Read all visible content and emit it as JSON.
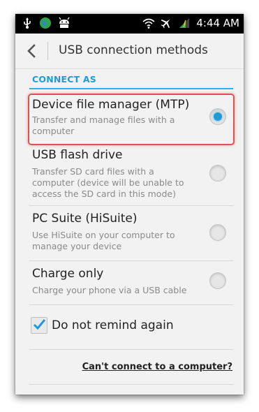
{
  "status_bar": {
    "time": "4:44 AM",
    "icons_left": [
      "usb-icon",
      "globe-icon",
      "android-icon"
    ],
    "icons_right": [
      "wifi-icon",
      "airplane-icon",
      "battery-icon"
    ]
  },
  "action_bar": {
    "title": "USB connection methods"
  },
  "section": {
    "header": "CONNECT AS"
  },
  "options": [
    {
      "title": "Device file manager (MTP)",
      "desc": "Transfer and manage files with a computer",
      "checked": true
    },
    {
      "title": "USB flash drive",
      "desc": "Transfer SD card files with a computer (device will be unable to access the SD card in this mode)",
      "checked": false
    },
    {
      "title": "PC Suite (HiSuite)",
      "desc": "Use HiSuite on your computer to manage your device",
      "checked": false
    },
    {
      "title": "Charge only",
      "desc": "Charge your phone via a USB cable",
      "checked": false
    }
  ],
  "do_not_remind": {
    "label": "Do not remind again",
    "checked": true
  },
  "help_link": "Can't connect to a computer?",
  "colors": {
    "accent": "#1f9bd7",
    "highlight_border": "#d9534f"
  }
}
